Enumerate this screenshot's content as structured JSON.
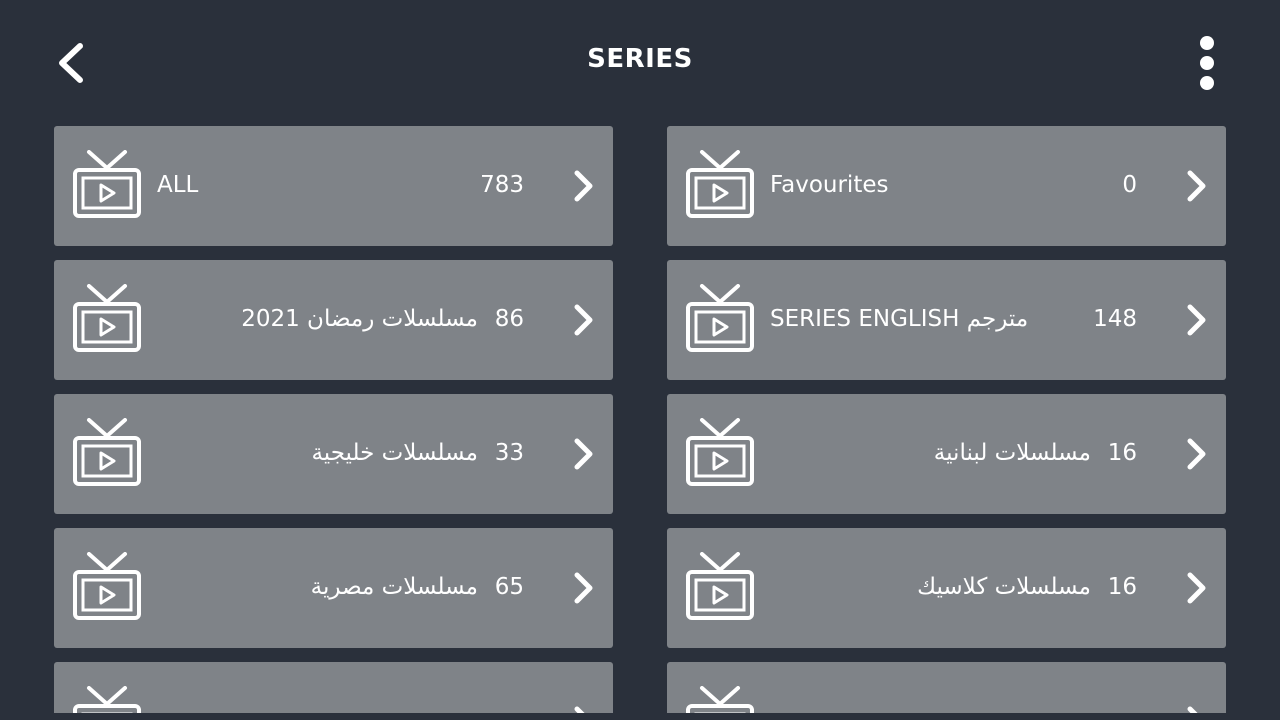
{
  "header": {
    "title": "SERIES"
  },
  "icons": {
    "back": "chevron-left-icon",
    "menu": "more-vertical-icon",
    "tile": "tv-play-icon",
    "row_arrow": "chevron-right-icon"
  },
  "colors": {
    "background": "#2a303b",
    "tile": "#7f8388",
    "text": "#ffffff"
  },
  "categories": [
    {
      "label": "ALL",
      "count": "783"
    },
    {
      "label": "Favourites",
      "count": "0"
    },
    {
      "label": "مسلسلات رمضان 2021",
      "count": "86"
    },
    {
      "label": "SERIES ENGLISH مترجم",
      "count": "148"
    },
    {
      "label": "مسلسلات خليجية",
      "count": "33"
    },
    {
      "label": "مسلسلات لبنانية",
      "count": "16"
    },
    {
      "label": "مسلسلات مصرية",
      "count": "65"
    },
    {
      "label": "مسلسلات كلاسيك",
      "count": "16"
    }
  ]
}
